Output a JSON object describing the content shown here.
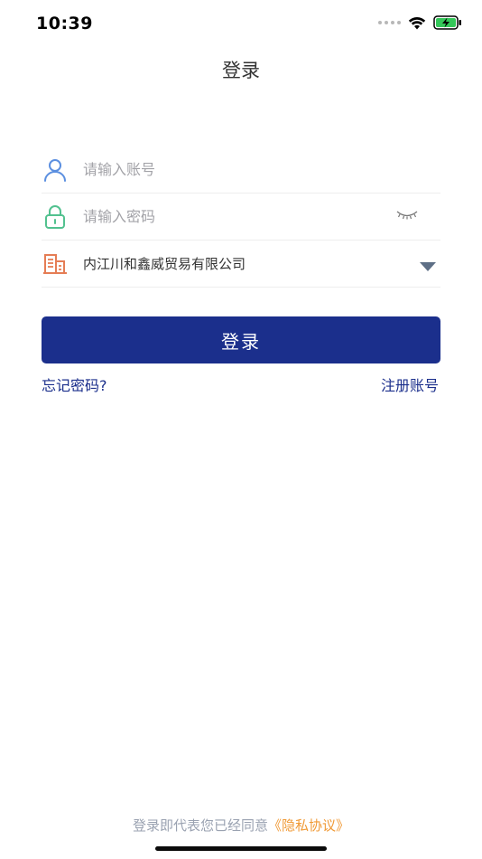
{
  "status_bar": {
    "time": "10:39"
  },
  "header": {
    "title": "登录"
  },
  "form": {
    "account": {
      "placeholder": "请输入账号",
      "value": ""
    },
    "password": {
      "placeholder": "请输入密码",
      "value": ""
    },
    "company": {
      "selected": "内江川和鑫威贸易有限公司"
    }
  },
  "actions": {
    "login_label": "登录",
    "forgot_password": "忘记密码?",
    "register": "注册账号"
  },
  "footer": {
    "agreement_prefix": "登录即代表您已经同意",
    "privacy_link": "《隐私协议》"
  },
  "colors": {
    "primary": "#1b2f8c",
    "user_icon": "#5b8fe0",
    "lock_icon": "#52c18f",
    "building_icon": "#e57d55",
    "privacy_link": "#f09a37"
  },
  "icons": [
    "user-icon",
    "lock-icon",
    "eye-closed-icon",
    "building-icon",
    "caret-down-icon",
    "wifi-icon",
    "battery-charging-icon"
  ]
}
